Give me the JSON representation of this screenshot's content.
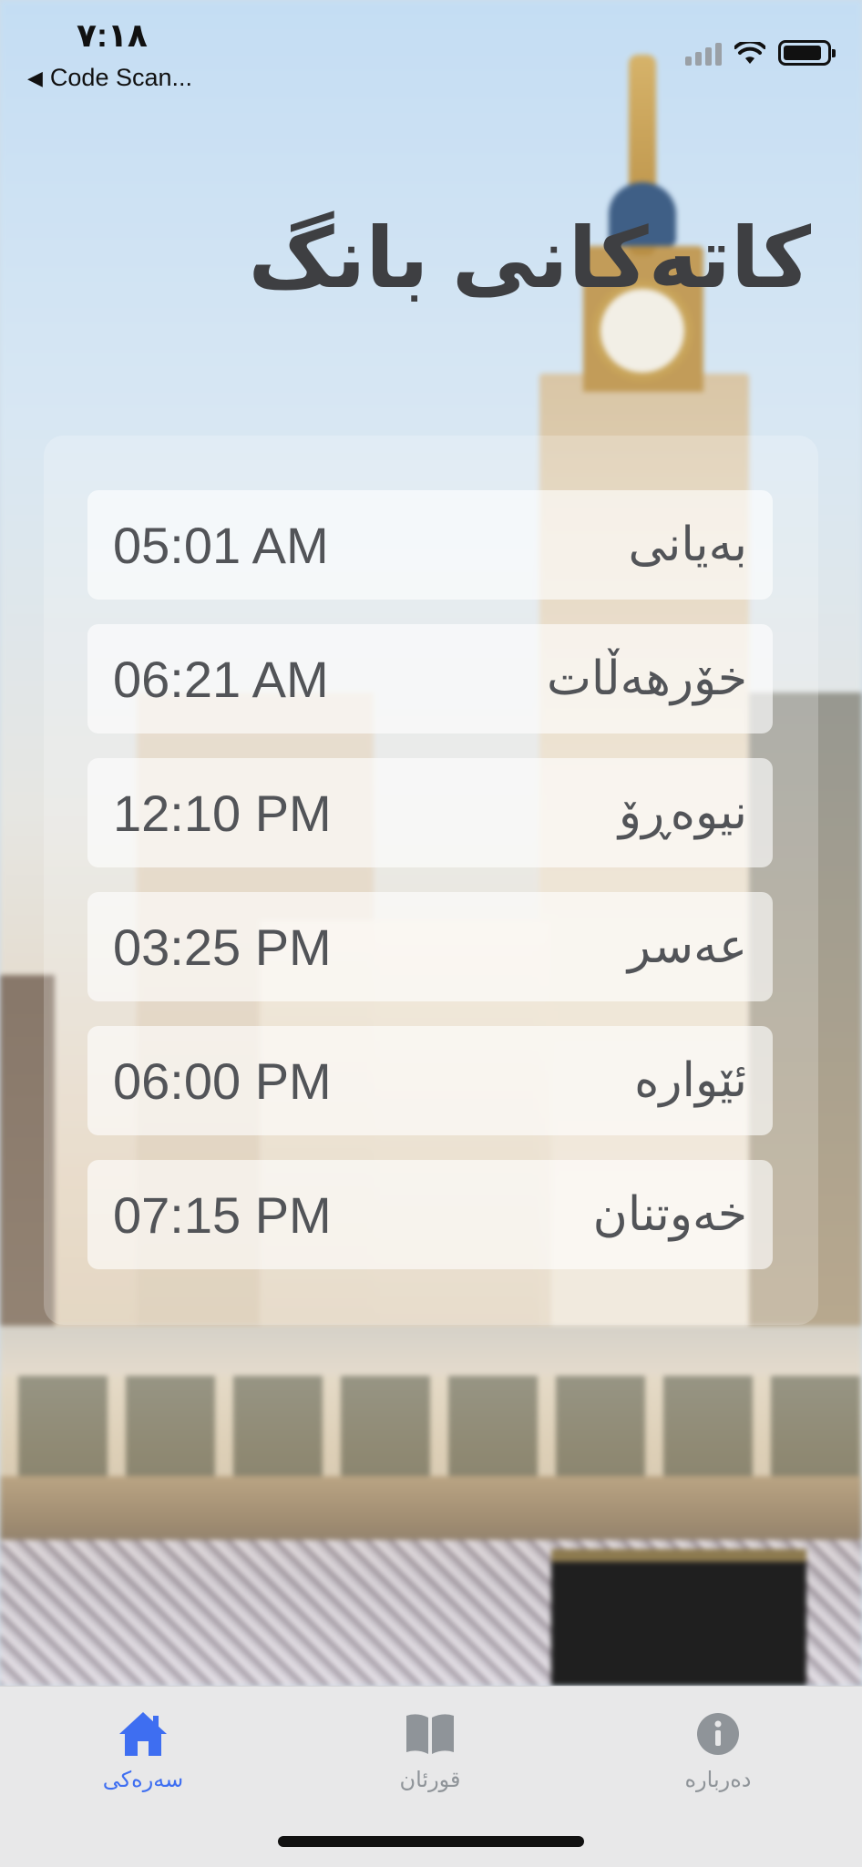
{
  "status_bar": {
    "time": "٧:١٨",
    "back_app": "Code Scan..."
  },
  "page": {
    "title": "کاتەکانی بانگ"
  },
  "prayer_times": [
    {
      "name": "بەیانی",
      "time": "05:01 AM"
    },
    {
      "name": "خۆرهەڵات",
      "time": "06:21 AM"
    },
    {
      "name": "نیوەڕۆ",
      "time": "12:10 PM"
    },
    {
      "name": "عەسر",
      "time": "03:25 PM"
    },
    {
      "name": "ئێوارە",
      "time": "06:00 PM"
    },
    {
      "name": "خەوتنان",
      "time": "07:15 PM"
    }
  ],
  "tab_bar": {
    "items": [
      {
        "label": "سەرەکی",
        "icon": "home-icon",
        "active": true
      },
      {
        "label": "قورئان",
        "icon": "book-icon",
        "active": false
      },
      {
        "label": "دەربارە",
        "icon": "info-icon",
        "active": false
      }
    ]
  },
  "colors": {
    "accent": "#3e6ef1",
    "inactive": "#8f9499",
    "text": "#525458"
  }
}
